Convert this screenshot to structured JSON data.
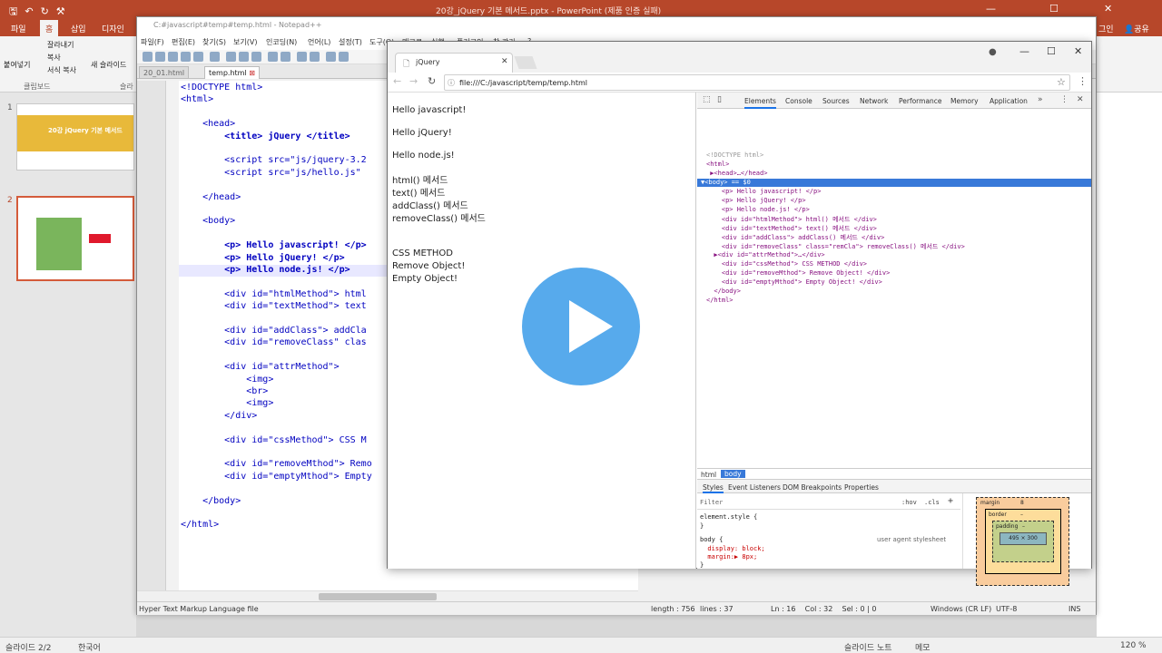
{
  "colors": {
    "accent": "#b7472a",
    "play": "#52a8ec",
    "selection": "#3879d9"
  },
  "ppt": {
    "title": "20강_jQuery 기본 메서드.pptx - PowerPoint (제품 인증 실패)",
    "tabs": [
      "파일",
      "홈",
      "삽입",
      "디자인"
    ],
    "share": "공유",
    "signin": "그인",
    "ribbon": {
      "paste": "붙여넣기",
      "cut": "잘라내기",
      "copy": "복사",
      "format_painter": "서식 복사",
      "new_slide": "새 슬라이드",
      "clipboard": "클립보드",
      "slide_group": "슬라"
    },
    "slide_numbers": [
      "1",
      "2"
    ],
    "slide1_title": "20강 jQuery 기본 메서드",
    "status": {
      "slide": "슬라이드 2/2",
      "lang": "한국어",
      "notes": "슬라이드 노트",
      "memo": "메모",
      "zoom": "120 %"
    }
  },
  "npp": {
    "title": "C:#javascript#temp#temp.html - Notepad++",
    "menu": [
      "파일(F)",
      "편집(E)",
      "찾기(S)",
      "보기(V)",
      "인코딩(N)",
      "언어(L)",
      "설정(T)",
      "도구(O)",
      "매크로",
      "실행",
      "플러그인",
      "창 관리",
      "?"
    ],
    "tabs": [
      "20_01.html",
      "temp.html"
    ],
    "lines": [
      {
        "n": "1",
        "code": "<!DOCTYPE html>"
      },
      {
        "n": "2",
        "code": "<html>"
      },
      {
        "n": "3",
        "code": ""
      },
      {
        "n": "4",
        "code": "    <head>"
      },
      {
        "n": "5",
        "code": "        <title> jQuery </title>"
      },
      {
        "n": "6",
        "code": ""
      },
      {
        "n": "7",
        "code": "        <script src=\"js/jquery-3.2"
      },
      {
        "n": "8",
        "code": "        <script src=\"js/hello.js\""
      },
      {
        "n": "9",
        "code": ""
      },
      {
        "n": "10",
        "code": "    </head>"
      },
      {
        "n": "11",
        "code": ""
      },
      {
        "n": "12",
        "code": "    <body>"
      },
      {
        "n": "13",
        "code": ""
      },
      {
        "n": "14",
        "code": "        <p> Hello javascript! </p>"
      },
      {
        "n": "15",
        "code": "        <p> Hello jQuery! </p>"
      },
      {
        "n": "16",
        "code": "        <p> Hello node.js! </p>"
      },
      {
        "n": "17",
        "code": ""
      },
      {
        "n": "18",
        "code": "        <div id=\"htmlMethod\"> html"
      },
      {
        "n": "19",
        "code": "        <div id=\"textMethod\"> text"
      },
      {
        "n": "20",
        "code": ""
      },
      {
        "n": "21",
        "code": "        <div id=\"addClass\"> addCla"
      },
      {
        "n": "22",
        "code": "        <div id=\"removeClass\" clas"
      },
      {
        "n": "23",
        "code": ""
      },
      {
        "n": "24",
        "code": "        <div id=\"attrMethod\">"
      },
      {
        "n": "25",
        "code": "            <img>"
      },
      {
        "n": "26",
        "code": "            <br>"
      },
      {
        "n": "27",
        "code": "            <img>"
      },
      {
        "n": "28",
        "code": "        </div>"
      },
      {
        "n": "29",
        "code": ""
      },
      {
        "n": "30",
        "code": "        <div id=\"cssMethod\"> CSS M"
      },
      {
        "n": "31",
        "code": ""
      },
      {
        "n": "32",
        "code": "        <div id=\"removeMthod\"> Remo"
      },
      {
        "n": "33",
        "code": "        <div id=\"emptyMthod\"> Empty"
      },
      {
        "n": "34",
        "code": ""
      },
      {
        "n": "35",
        "code": "    </body>"
      },
      {
        "n": "36",
        "code": ""
      },
      {
        "n": "37",
        "code": "</html>"
      }
    ],
    "status": {
      "type": "Hyper Text Markup Language file",
      "length": "length : 756",
      "lines": "lines : 37",
      "pos": "Ln : 16    Col : 32    Sel : 0 | 0",
      "eol": "Windows (CR LF)",
      "enc": "UTF-8",
      "ins": "INS"
    }
  },
  "chrome": {
    "tab_title": "jQuery",
    "url": "file:///C:/javascript/temp/temp.html",
    "page": [
      "Hello javascript!",
      "Hello jQuery!",
      "Hello node.js!",
      "html() 메서드",
      "text() 메서드",
      "addClass() 메서드",
      "removeClass() 메서드",
      "CSS METHOD",
      "Remove Object!",
      "Empty Object!"
    ],
    "devtools": {
      "tabs": [
        "Elements",
        "Console",
        "Sources",
        "Network",
        "Performance",
        "Memory",
        "Application"
      ],
      "dom": [
        "<!DOCTYPE html>",
        "<html>",
        " ▶<head>…</head>",
        "▼<body> == $0",
        "    <p> Hello javascript! </p>",
        "    <p> Hello jQuery! </p>",
        "    <p> Hello node.js! </p>",
        "    <div id=\"htmlMethod\"> html() 메서드 </div>",
        "    <div id=\"textMethod\"> text() 메서드 </div>",
        "    <div id=\"addClass\"> addClass() 메서드 </div>",
        "    <div id=\"removeClass\" class=\"remCla\"> removeClass() 메서드 </div>",
        "  ▶<div id=\"attrMethod\">…</div>",
        "    <div id=\"cssMethod\"> CSS METHOD </div>",
        "    <div id=\"removeMthod\"> Remove Object! </div>",
        "    <div id=\"emptyMthod\"> Empty Object! </div>",
        "  </body>",
        "</html>"
      ],
      "crumbs": [
        "html",
        "body"
      ],
      "subtabs": [
        "Styles",
        "Event Listeners",
        "DOM Breakpoints",
        "Properties"
      ],
      "filter": "Filter",
      "hov": ":hov",
      "cls": ".cls",
      "styles": [
        "element.style {",
        "}",
        "body {",
        "  display: block;",
        "  margin:▶ 8px;",
        "}"
      ],
      "ua": "user agent stylesheet",
      "box": {
        "margin": "margin",
        "border": "border",
        "padding": "padding",
        "dash": "–",
        "content": "495 × 300",
        "m": "8"
      }
    }
  }
}
